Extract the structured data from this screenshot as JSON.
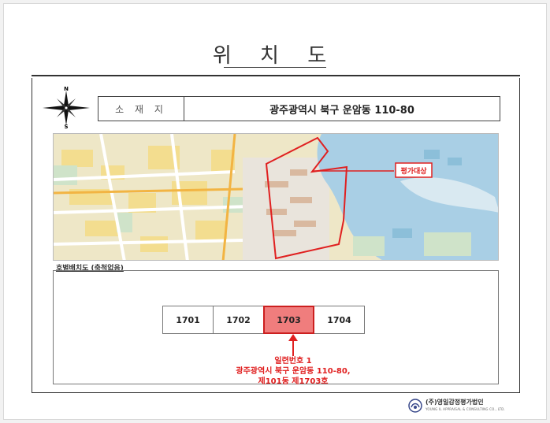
{
  "title": "위 치 도",
  "compass": {
    "north": "N",
    "south": "S"
  },
  "location": {
    "label": "소 재 지",
    "value": "광주광역시 북구 운암동 110-80"
  },
  "map": {
    "target_label": "평가대상"
  },
  "layout_section": {
    "label": "호별배치도 (축척없음)",
    "units": [
      {
        "number": "1701",
        "selected": false
      },
      {
        "number": "1702",
        "selected": false
      },
      {
        "number": "1703",
        "selected": true
      },
      {
        "number": "1704",
        "selected": false
      }
    ],
    "note_lines": [
      "일련번호 1",
      "광주광역시 북구 운암동 110-80,",
      "제101동 제1703호"
    ]
  },
  "footer": {
    "company_name": "(주)영일감정평가법인",
    "company_sub": "YOUNG IL APPRAISAL & CONSULTING CO., LTD."
  },
  "colors": {
    "highlight_fill": "#f07d7d",
    "highlight_border": "#cc1f1f",
    "annotation": "#e02020"
  }
}
